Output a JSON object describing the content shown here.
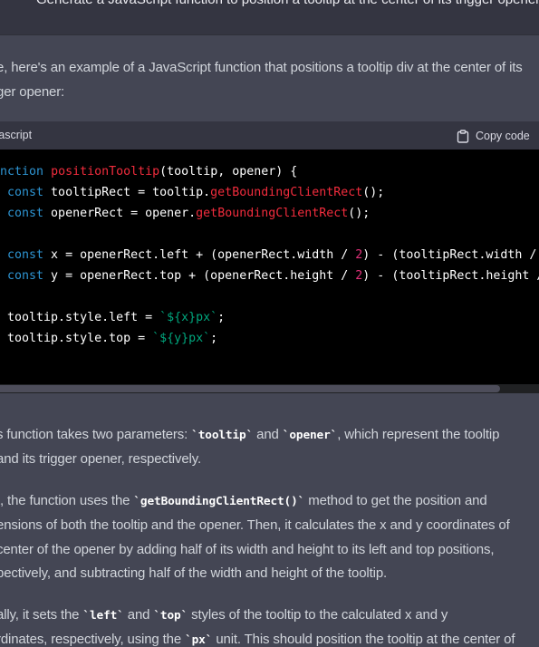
{
  "top_strip": {
    "clipped_text": "Generate a JavaScript function to position a tooltip at the center of its trigger opener"
  },
  "intro": {
    "line1": "e, here's an example of a JavaScript function that positions a tooltip div at the center of its",
    "line2": "ger opener:"
  },
  "code_block": {
    "language": "vascript",
    "copy_label": "Copy code",
    "lines": [
      "unction positionTooltip(tooltip, opener) {",
      " const tooltipRect = tooltip.getBoundingClientRect();",
      " const openerRect = opener.getBoundingClientRect();",
      "",
      " const x = openerRect.left + (openerRect.width / 2) - (tooltipRect.width /",
      " const y = openerRect.top + (openerRect.height / 2) - (tooltipRect.height /",
      "",
      " tooltip.style.left = `${x}px`;",
      " tooltip.style.top = `${y}px`;"
    ]
  },
  "para1": {
    "l1_a": "s function takes two parameters: ",
    "l1_code1": "`tooltip`",
    "l1_b": " and ",
    "l1_code2": "`opener`",
    "l1_c": ", which represent the tooltip",
    "l2": "and its trigger opener, respectively."
  },
  "para2": {
    "l1_a": "t, the function uses the ",
    "l1_code": "`getBoundingClientRect()`",
    "l1_b": " method to get the position and",
    "l2": "ensions of both the tooltip and the opener. Then, it calculates the x and y coordinates of",
    "l3": "center of the opener by adding half of its width and height to its left and top positions,",
    "l4": "pectively, and subtracting half of the width and height of the tooltip."
  },
  "para3": {
    "l1_a": "ally, it sets the ",
    "l1_code1": "`left`",
    "l1_b": " and ",
    "l1_code2": "`top`",
    "l1_c": " styles of the tooltip to the calculated x and y",
    "l2_a": "rdinates, respectively, using the ",
    "l2_code": "`px`",
    "l2_b": " unit. This should position the tooltip at the center of"
  },
  "icons": {
    "copy": "clipboard-icon"
  }
}
